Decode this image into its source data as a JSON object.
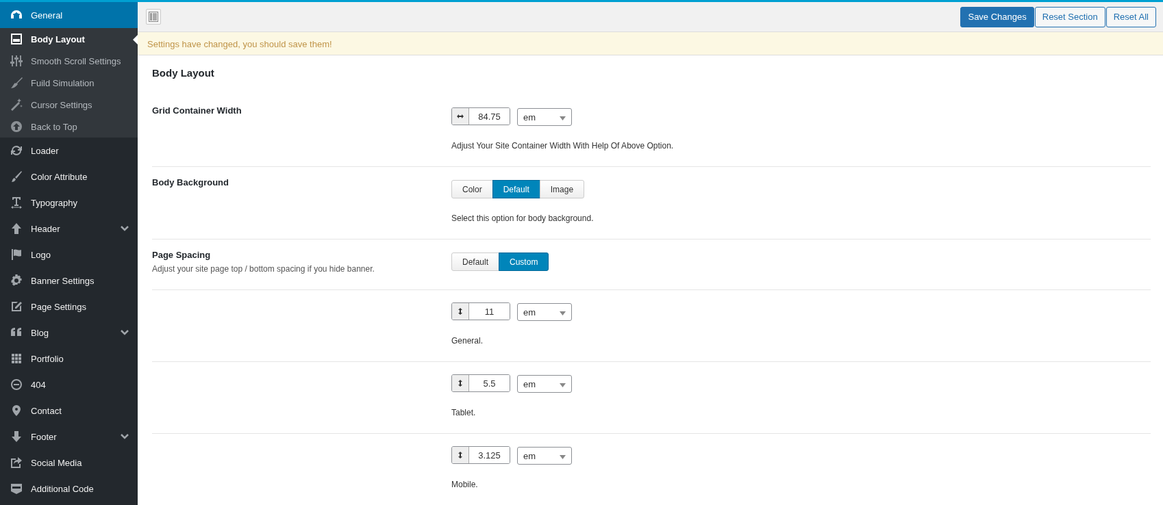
{
  "sidebar": {
    "items": [
      {
        "label": "General",
        "selected": true,
        "expandable": false,
        "children": [
          {
            "label": "Body Layout",
            "selected": true
          },
          {
            "label": "Smooth Scroll Settings",
            "selected": false
          },
          {
            "label": "Fuild Simulation",
            "selected": false
          },
          {
            "label": "Cursor Settings",
            "selected": false
          },
          {
            "label": "Back to Top",
            "selected": false
          }
        ]
      },
      {
        "label": "Loader",
        "selected": false,
        "expandable": false
      },
      {
        "label": "Color Attribute",
        "selected": false,
        "expandable": false
      },
      {
        "label": "Typography",
        "selected": false,
        "expandable": false
      },
      {
        "label": "Header",
        "selected": false,
        "expandable": true
      },
      {
        "label": "Logo",
        "selected": false,
        "expandable": false
      },
      {
        "label": "Banner Settings",
        "selected": false,
        "expandable": false
      },
      {
        "label": "Page Settings",
        "selected": false,
        "expandable": false
      },
      {
        "label": "Blog",
        "selected": false,
        "expandable": true
      },
      {
        "label": "Portfolio",
        "selected": false,
        "expandable": false
      },
      {
        "label": "404",
        "selected": false,
        "expandable": false
      },
      {
        "label": "Contact",
        "selected": false,
        "expandable": false
      },
      {
        "label": "Footer",
        "selected": false,
        "expandable": true
      },
      {
        "label": "Social Media",
        "selected": false,
        "expandable": false
      },
      {
        "label": "Additional Code",
        "selected": false,
        "expandable": false
      }
    ]
  },
  "toolbar": {
    "buttons": [
      {
        "label": "Save Changes",
        "kind": "primary"
      },
      {
        "label": "Reset Section",
        "kind": "secondary"
      },
      {
        "label": "Reset All",
        "kind": "secondary"
      }
    ]
  },
  "notice": "Settings have changed, you should save them!",
  "section": {
    "title": "Body Layout",
    "rows": [
      {
        "kind": "width",
        "label": "Grid Container Width",
        "value": "84.75",
        "unit": "em",
        "help": "Adjust Your Site Container Width With Help Of Above Option."
      },
      {
        "kind": "buttonset",
        "label": "Body Background",
        "options": [
          {
            "label": "Color",
            "selected": false
          },
          {
            "label": "Default",
            "selected": true
          },
          {
            "label": "Image",
            "selected": false
          }
        ],
        "help": "Select this option for body background."
      },
      {
        "kind": "buttonset",
        "label": "Page Spacing",
        "description": "Adjust your site page top / bottom spacing if you hide banner.",
        "options": [
          {
            "label": "Default",
            "selected": false
          },
          {
            "label": "Custom",
            "selected": true
          }
        ]
      },
      {
        "kind": "height",
        "value": "11",
        "unit": "em",
        "help": "General."
      },
      {
        "kind": "height",
        "value": "5.5",
        "unit": "em",
        "help": "Tablet."
      },
      {
        "kind": "height",
        "value": "3.125",
        "unit": "em",
        "help": "Mobile."
      }
    ]
  }
}
